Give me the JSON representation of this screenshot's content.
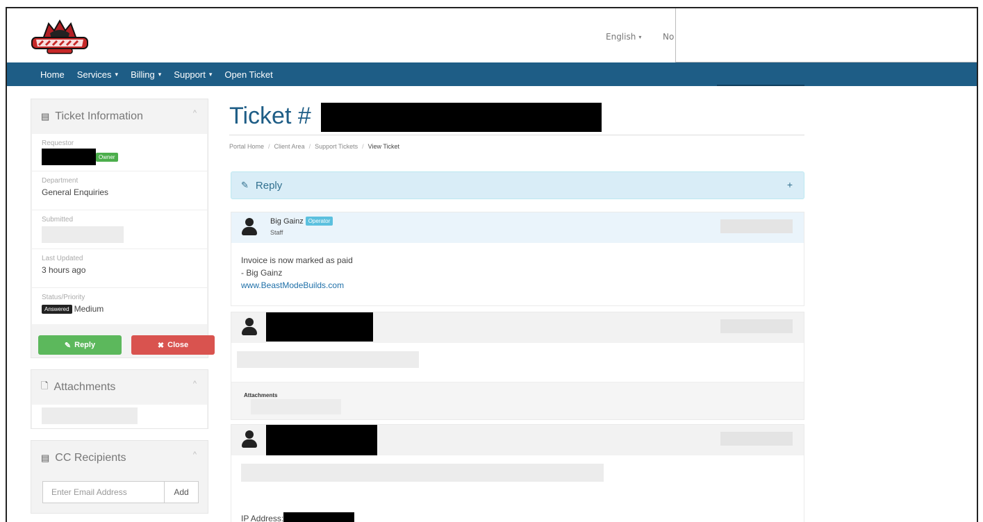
{
  "header": {
    "language_label": "English",
    "language_caret": "▾",
    "partial_link": "No"
  },
  "nav": {
    "items": [
      {
        "label": "Home",
        "has_caret": false
      },
      {
        "label": "Services",
        "has_caret": true
      },
      {
        "label": "Billing",
        "has_caret": true
      },
      {
        "label": "Support",
        "has_caret": true
      },
      {
        "label": "Open Ticket",
        "has_caret": false
      }
    ],
    "caret": "▾"
  },
  "ticket_info": {
    "title": "Ticket Information",
    "requestor_label": "Requestor",
    "owner_badge": "Owner",
    "department_label": "Department",
    "department_value": "General Enquiries",
    "submitted_label": "Submitted",
    "last_updated_label": "Last Updated",
    "last_updated_value": "3 hours ago",
    "status_priority_label": "Status/Priority",
    "status_badge": "Answered",
    "priority_value": "Medium",
    "reply_button": "Reply",
    "close_button": "Close"
  },
  "attachments_panel": {
    "title": "Attachments"
  },
  "cc_panel": {
    "title": "CC Recipients",
    "email_placeholder": "Enter Email Address",
    "add_button": "Add"
  },
  "main": {
    "title": "Ticket #",
    "breadcrumb": [
      "Portal Home",
      "Client Area",
      "Support Tickets",
      "View Ticket"
    ],
    "reply_bar_label": "Reply",
    "reply_bar_plus": "+"
  },
  "messages": {
    "staff": {
      "name": "Big Gainz",
      "badge": "Operator",
      "role": "Staff",
      "body_line1": "Invoice is now marked as paid",
      "body_line2": "- Big Gainz",
      "body_link": "www.BeastModeBuilds.com"
    },
    "client1": {
      "attachments_label": "Attachments"
    },
    "client2": {
      "ip_label": "IP Address:"
    }
  },
  "icons": {
    "ticket": "▤",
    "file": "🗋",
    "cc": "▤",
    "chevron": "^",
    "pencil": "✎",
    "close": "✖"
  },
  "colors": {
    "nav_bg": "#1e5d86",
    "title_blue": "#1e5d86",
    "reply_green": "#5cb85c",
    "close_red": "#d9534f",
    "reply_bar_bg": "#d9edf7"
  }
}
